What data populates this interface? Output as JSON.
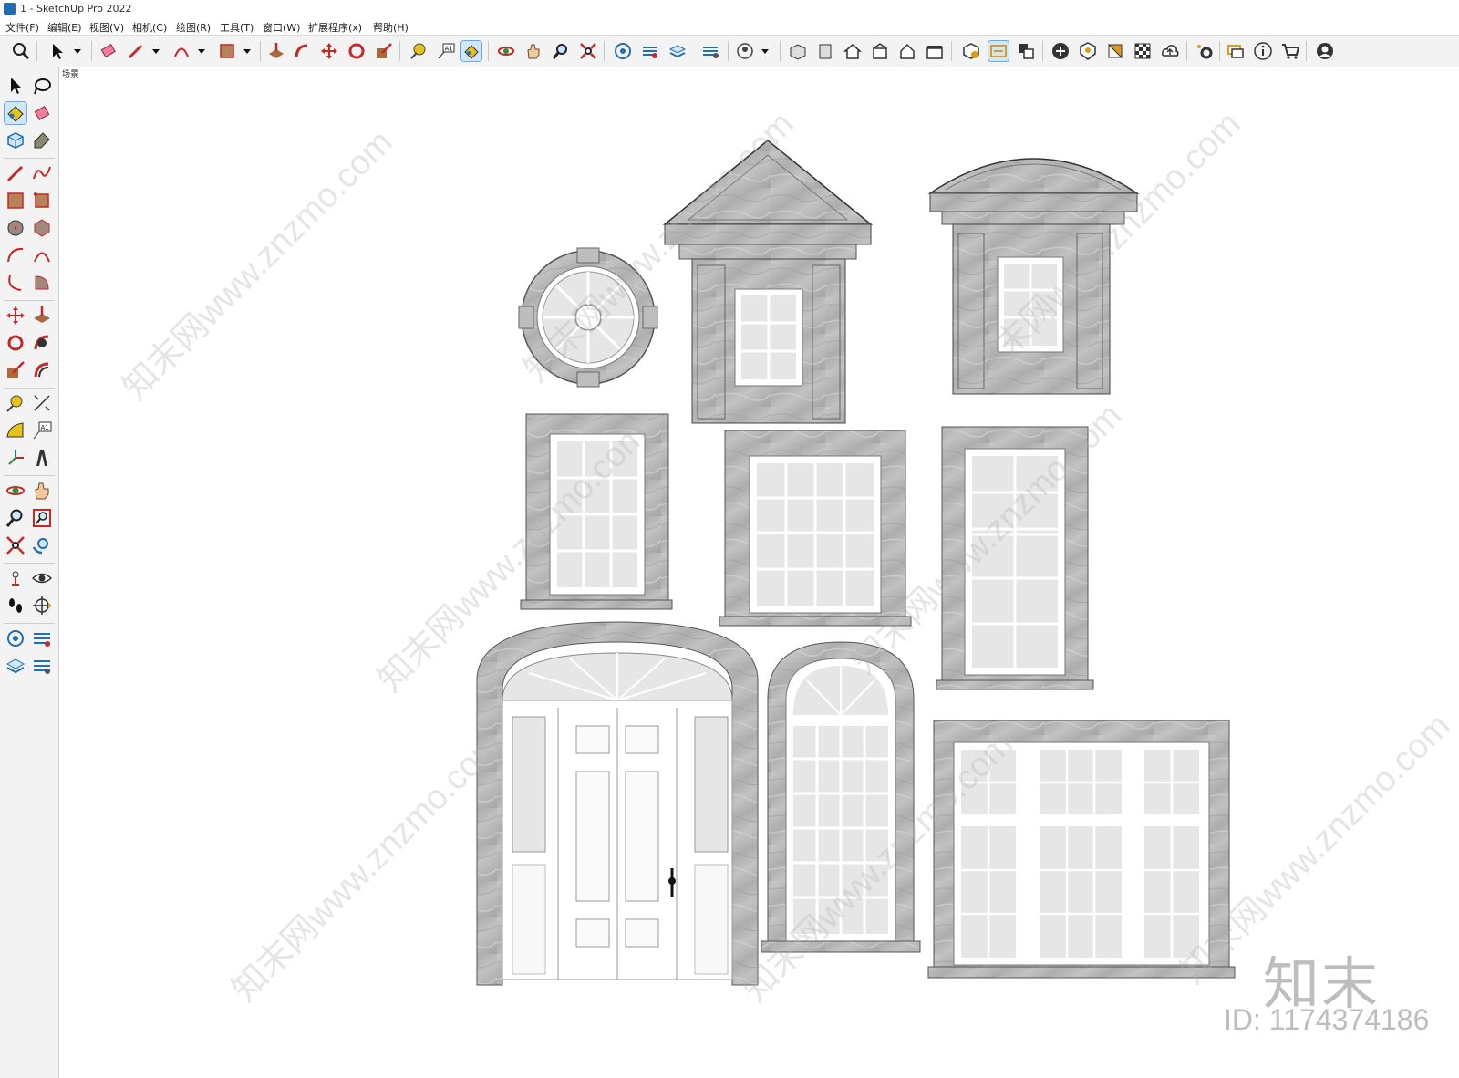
{
  "window": {
    "title": "1 - SketchUp Pro 2022"
  },
  "menu": [
    "文件(F)",
    "编辑(E)",
    "视图(V)",
    "相机(C)",
    "绘图(R)",
    "工具(T)",
    "窗口(W)",
    "扩展程序(x)",
    "帮助(H)"
  ],
  "scene": {
    "tab_label": "场景"
  },
  "watermark": {
    "logo": "知末",
    "id": "ID: 1174374186",
    "site": "知末网www.znzmo.com"
  },
  "colors": {
    "stone": "#b9b9b9",
    "glass": "#e6e6e6",
    "frame": "#ffffff",
    "active": "#cfe6ff"
  }
}
